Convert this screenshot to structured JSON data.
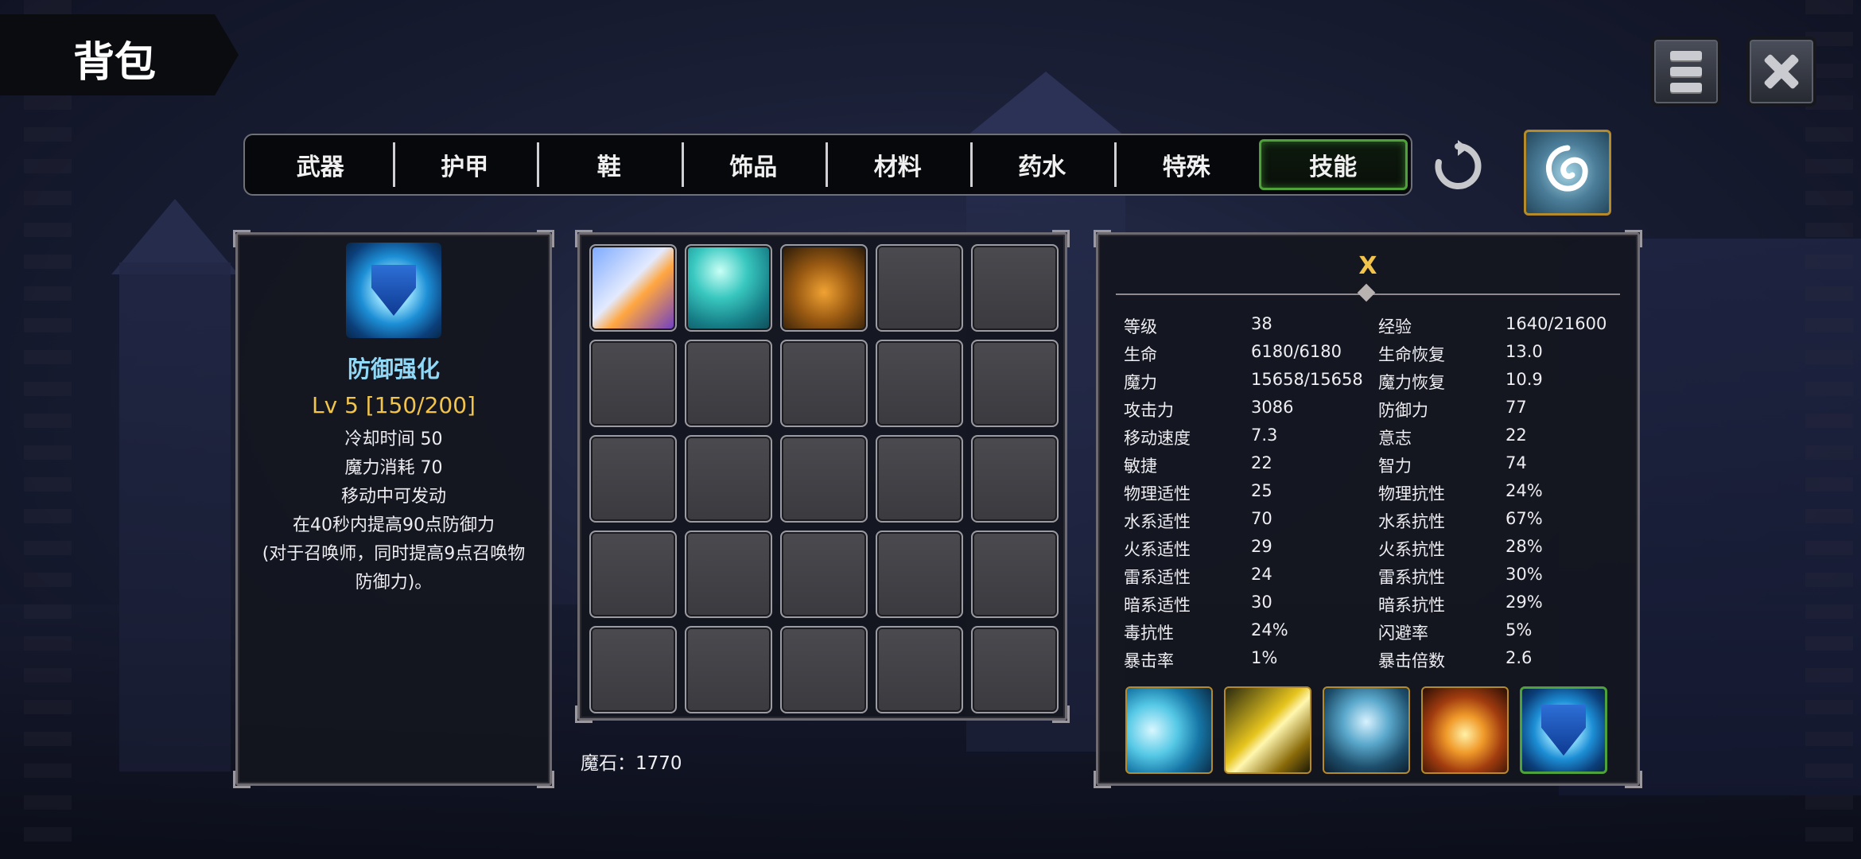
{
  "title": "背包",
  "tabs": [
    {
      "label": "武器",
      "active": false
    },
    {
      "label": "护甲",
      "active": false
    },
    {
      "label": "鞋",
      "active": false
    },
    {
      "label": "饰品",
      "active": false
    },
    {
      "label": "材料",
      "active": false
    },
    {
      "label": "药水",
      "active": false
    },
    {
      "label": "特殊",
      "active": false
    },
    {
      "label": "技能",
      "active": true
    }
  ],
  "selected_skill": {
    "name": "防御强化",
    "level": "Lv 5 [150/200]",
    "cooldown": "冷却时间 50",
    "mana_cost": "魔力消耗 70",
    "castable_while_moving": "移动中可发动",
    "desc_line1": "在40秒内提高90点防御力",
    "desc_line2": "(对于召唤师，同时提高9点召唤物",
    "desc_line3": "防御力)。"
  },
  "inventory": {
    "rows": 5,
    "cols": 5,
    "items": [
      "skill-light-beam",
      "skill-water-splash",
      "skill-gold-orbs"
    ]
  },
  "currency": "魔石：1770",
  "character": {
    "name": "X",
    "stats": [
      {
        "l1": "等级",
        "v1": "38",
        "l2": "经验",
        "v2": "1640/21600"
      },
      {
        "l1": "生命",
        "v1": "6180/6180",
        "l2": "生命恢复",
        "v2": "13.0"
      },
      {
        "l1": "魔力",
        "v1": "15658/15658",
        "l2": "魔力恢复",
        "v2": "10.9"
      },
      {
        "l1": "攻击力",
        "v1": "3086",
        "l2": "防御力",
        "v2": "77"
      },
      {
        "l1": "移动速度",
        "v1": "7.3",
        "l2": "意志",
        "v2": "22"
      },
      {
        "l1": "敏捷",
        "v1": "22",
        "l2": "智力",
        "v2": "74"
      },
      {
        "l1": "物理适性",
        "v1": "25",
        "l2": "物理抗性",
        "v2": "24%"
      },
      {
        "l1": "水系适性",
        "v1": "70",
        "l2": "水系抗性",
        "v2": "67%"
      },
      {
        "l1": "火系适性",
        "v1": "29",
        "l2": "火系抗性",
        "v2": "28%"
      },
      {
        "l1": "雷系适性",
        "v1": "24",
        "l2": "雷系抗性",
        "v2": "30%"
      },
      {
        "l1": "暗系适性",
        "v1": "30",
        "l2": "暗系抗性",
        "v2": "29%"
      },
      {
        "l1": "毒抗性",
        "v1": "24%",
        "l2": "闪避率",
        "v2": "5%"
      },
      {
        "l1": "暴击率",
        "v1": "1%",
        "l2": "暴击倍数",
        "v2": "2.6"
      }
    ],
    "equipped_skills": [
      "water-wave-icon",
      "light-slash-icon",
      "spirit-figure-icon",
      "fire-hand-icon",
      "defense-shield-icon"
    ]
  },
  "colors": {
    "active_tab_border": "#4fa23a",
    "skill_name": "#8fd8f6",
    "level_text": "#f2c44b",
    "item_border_gold": "#b58a2b"
  }
}
